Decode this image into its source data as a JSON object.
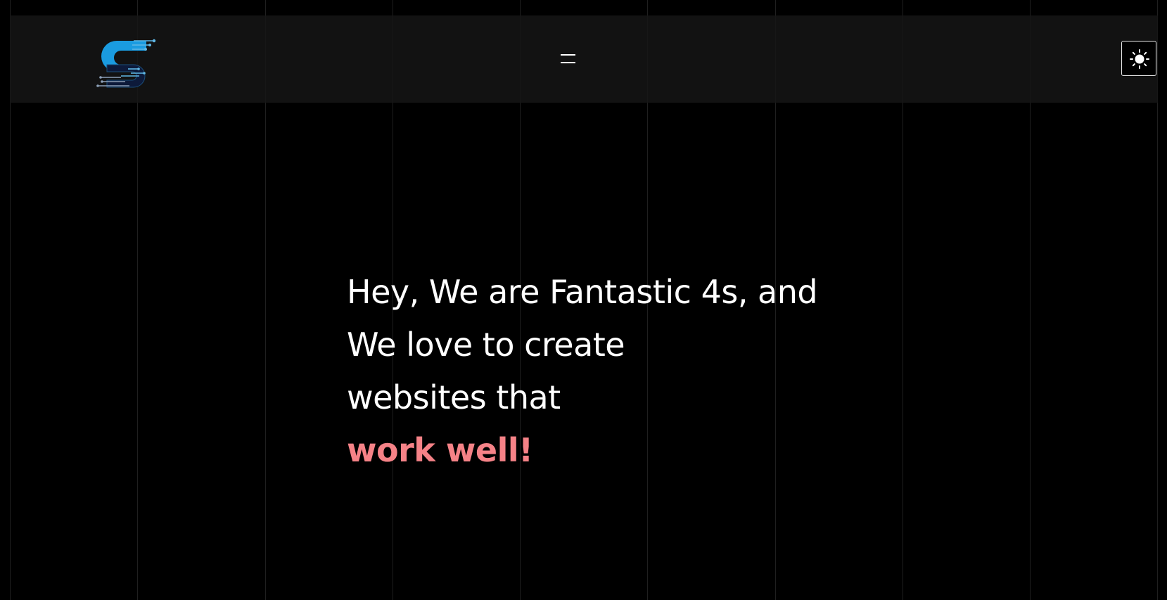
{
  "header": {
    "logo_icon": "brand-s-circuit-logo",
    "menu_icon": "hamburger-menu-icon",
    "theme_toggle_icon": "sun-icon"
  },
  "hero": {
    "line_1": "Hey, We are Fantastic 4s, and",
    "line_2": "We love to create",
    "line_3": "websites that",
    "highlight": "work well!"
  },
  "colors": {
    "background": "#000000",
    "navbar": "#141414",
    "text": "#ffffff",
    "accent": "#f58287",
    "logo_blue": "#1a9be0",
    "logo_navy": "#0d1a3a"
  }
}
